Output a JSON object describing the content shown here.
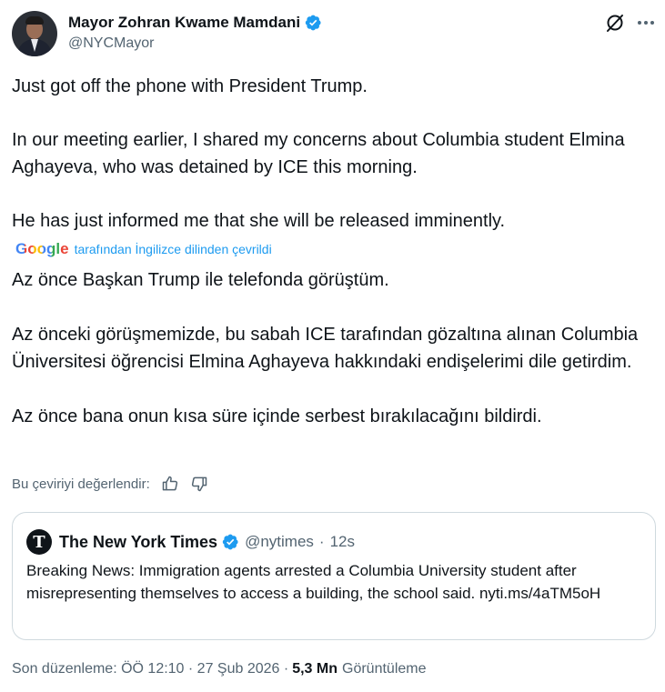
{
  "author": {
    "display_name": "Mayor Zohran Kwame Mamdani",
    "handle": "@NYCMayor",
    "verified_color": "#1d9bf0"
  },
  "tweet": {
    "lines": [
      "Just got off the phone with President Trump.",
      "In our meeting earlier, I shared my concerns about Columbia student Elmina Aghayeva, who was detained by ICE this morning.",
      "He has just informed me that she will be released imminently."
    ]
  },
  "translation": {
    "provider": "Google",
    "note": "tarafından İngilizce dilinden çevrildi",
    "lines": [
      "Az önce Başkan Trump ile telefonda görüştüm.",
      "Az önceki görüşmemizde, bu sabah ICE tarafından gözaltına alınan Columbia Üniversitesi öğrencisi Elmina Aghayeva hakkındaki endişelerimi dile getirdim.",
      "Az önce bana onun kısa süre içinde serbest bırakılacağını bildirdi."
    ],
    "rate_label": "Bu çeviriyi değerlendir:"
  },
  "quote": {
    "name": "The New York Times",
    "handle": "@nytimes",
    "separator": "·",
    "time": "12s",
    "avatar_letter": "T",
    "body": "Breaking News: Immigration agents arrested a Columbia University student after misrepresenting themselves to access a building, the school said. nyti.ms/4aTM5oH"
  },
  "meta": {
    "edited_label": "Son düzenleme: ÖÖ 12:10 · 27 Şub 2026 ·",
    "views_count": "5,3 Mn",
    "views_label": "Görüntüleme"
  },
  "icons": {
    "grok": "grok-icon",
    "more": "more-icon",
    "thumbs_up": "thumbs-up-icon",
    "thumbs_down": "thumbs-down-icon",
    "verified": "verified-badge-icon"
  }
}
